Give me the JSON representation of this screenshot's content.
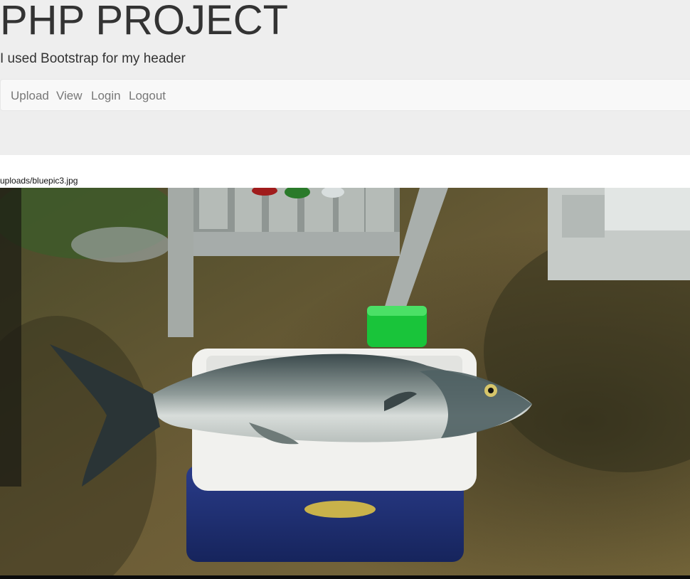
{
  "header": {
    "title": "PHP PROJECT",
    "tagline": "I used Bootstrap for my header"
  },
  "nav": {
    "items": [
      {
        "label": "Upload"
      },
      {
        "label": "View"
      },
      {
        "label": "Login"
      },
      {
        "label": "Logout"
      }
    ]
  },
  "content": {
    "file_path": "uploads/bluepic3.jpg"
  },
  "colors": {
    "jumbotron_bg": "#eeeeee",
    "navbar_bg": "#f8f8f8",
    "nav_link": "#777777",
    "title_text": "#333333"
  }
}
